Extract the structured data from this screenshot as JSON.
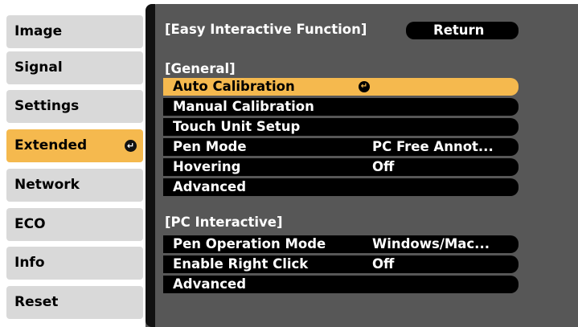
{
  "sidebar": {
    "items": [
      {
        "label": "Image"
      },
      {
        "label": "Signal"
      },
      {
        "label": "Settings"
      },
      {
        "label": "Extended"
      },
      {
        "label": "Network"
      },
      {
        "label": "ECO"
      },
      {
        "label": "Info"
      },
      {
        "label": "Reset"
      }
    ],
    "active_index": 3
  },
  "panel": {
    "title": "[Easy Interactive Function]",
    "return_label": "Return",
    "sections": [
      {
        "heading": "[General]",
        "rows": [
          {
            "label": "Auto Calibration",
            "value": ""
          },
          {
            "label": "Manual Calibration",
            "value": ""
          },
          {
            "label": "Touch Unit Setup",
            "value": ""
          },
          {
            "label": "Pen Mode",
            "value": "PC Free Annot..."
          },
          {
            "label": "Hovering",
            "value": "Off"
          },
          {
            "label": "Advanced",
            "value": ""
          }
        ]
      },
      {
        "heading": "[PC Interactive]",
        "rows": [
          {
            "label": "Pen Operation Mode",
            "value": "Windows/Mac..."
          },
          {
            "label": "Enable Right Click",
            "value": "Off"
          },
          {
            "label": "Advanced",
            "value": ""
          }
        ]
      }
    ]
  },
  "icons": {
    "enter": "enter-icon"
  },
  "colors": {
    "highlight": "#f5b94e",
    "menu_bg": "#d9d9d9",
    "panel_bg": "#575757",
    "row_bg": "#000000"
  }
}
